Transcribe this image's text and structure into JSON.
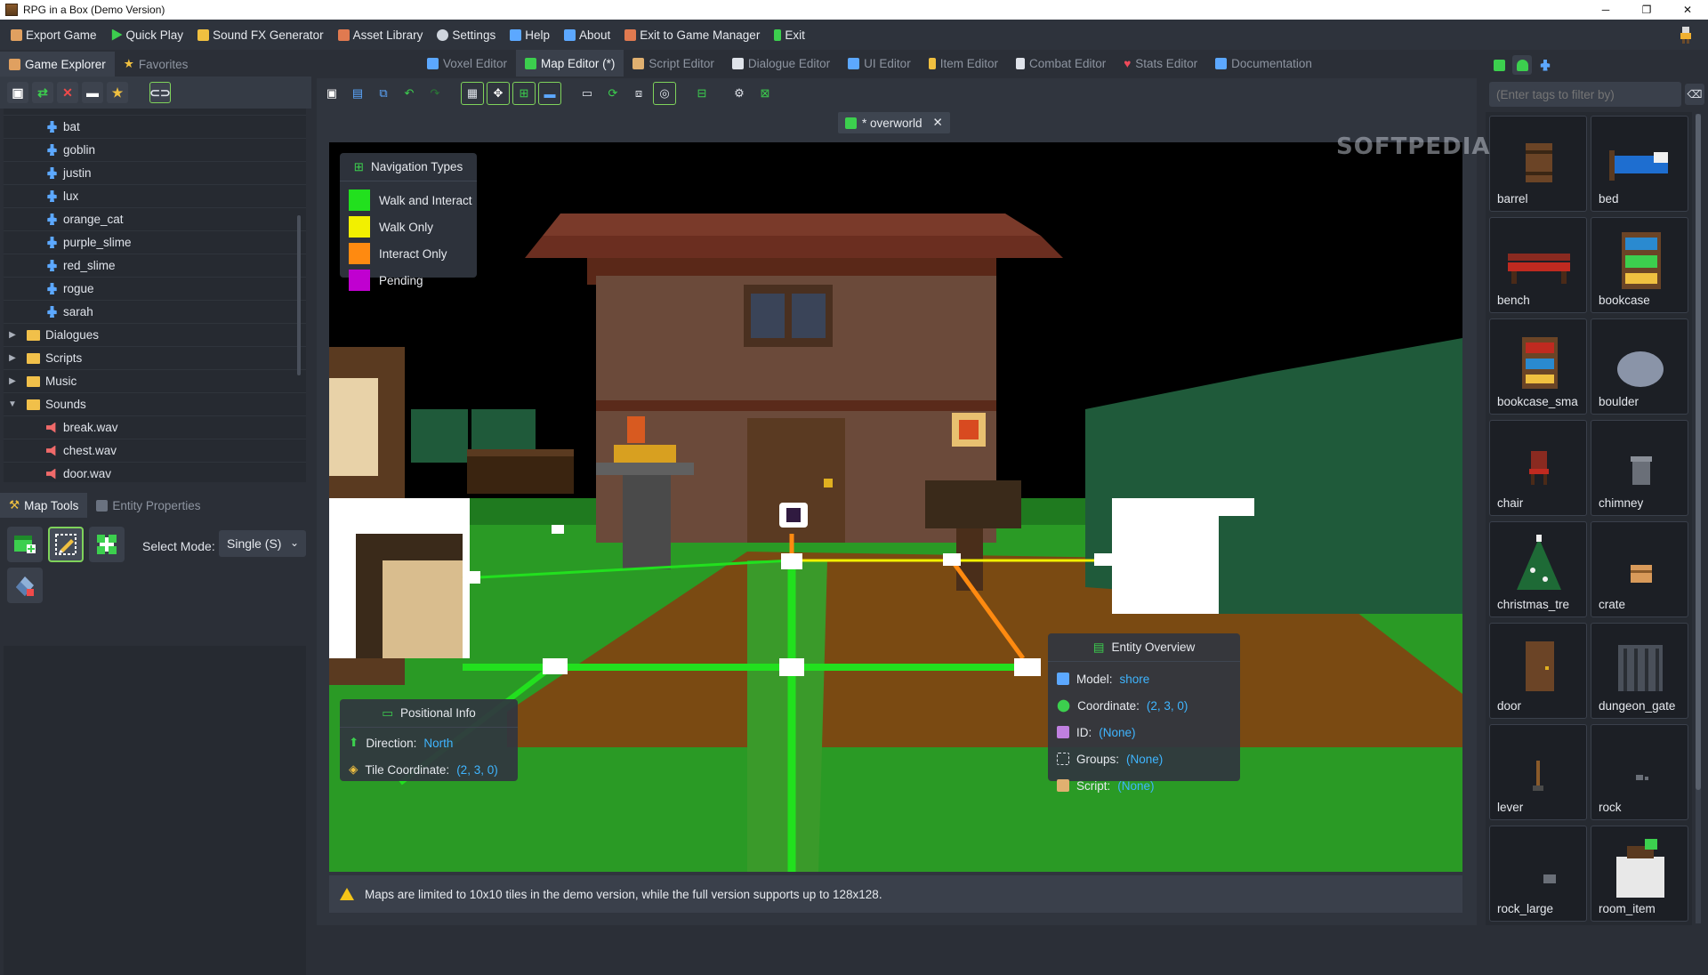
{
  "window": {
    "title": "RPG in a Box (Demo Version)",
    "minimize": "─",
    "maximize": "❐",
    "close": "✕"
  },
  "menu": [
    {
      "label": "Export Game",
      "color": "#e0a060"
    },
    {
      "label": "Quick Play",
      "color": "#3ccf4e"
    },
    {
      "label": "Sound FX Generator",
      "color": "#f0c040"
    },
    {
      "label": "Asset Library",
      "color": "#e07a50"
    },
    {
      "label": "Settings",
      "color": "#cfd5de"
    },
    {
      "label": "Help",
      "color": "#5ca8ff"
    },
    {
      "label": "About",
      "color": "#5ca8ff"
    },
    {
      "label": "Exit to Game Manager",
      "color": "#e07a50"
    },
    {
      "label": "Exit",
      "color": "#3ccf4e"
    }
  ],
  "left_dock": {
    "tabs": [
      "Game Explorer",
      "Favorites"
    ],
    "tree": {
      "characters": [
        "bat",
        "goblin",
        "justin",
        "lux",
        "orange_cat",
        "purple_slime",
        "red_slime",
        "rogue",
        "sarah"
      ],
      "folders": [
        "Dialogues",
        "Scripts",
        "Music",
        "Sounds"
      ],
      "sounds": [
        "break.wav",
        "chest.wav",
        "door.wav"
      ]
    },
    "lower_tabs": [
      "Map Tools",
      "Entity Properties"
    ],
    "select_mode_label": "Select Mode:",
    "select_mode_value": "Single (S)"
  },
  "editor_tabs": [
    {
      "label": "Voxel Editor",
      "color": "#5ca8ff"
    },
    {
      "label": "Map Editor (*)",
      "color": "#3ccf4e"
    },
    {
      "label": "Script Editor",
      "color": "#e0b070"
    },
    {
      "label": "Dialogue Editor",
      "color": "#dfe3ea"
    },
    {
      "label": "UI Editor",
      "color": "#5ca8ff"
    },
    {
      "label": "Item Editor",
      "color": "#f0c040"
    },
    {
      "label": "Combat Editor",
      "color": "#dfe3ea"
    },
    {
      "label": "Stats Editor",
      "color": "#f04a5a"
    },
    {
      "label": "Documentation",
      "color": "#5ca8ff"
    }
  ],
  "map_tab": {
    "label": "* overworld",
    "close": "✕"
  },
  "navigation_types": {
    "title": "Navigation Types",
    "items": [
      {
        "label": "Walk and Interact",
        "color": "#22e01e"
      },
      {
        "label": "Walk Only",
        "color": "#f2f000"
      },
      {
        "label": "Interact Only",
        "color": "#ff8a10"
      },
      {
        "label": "Pending",
        "color": "#c000d0"
      }
    ]
  },
  "positional_info": {
    "title": "Positional Info",
    "direction_label": "Direction:",
    "direction_value": "North",
    "tile_label": "Tile Coordinate:",
    "tile_value": "(2, 3, 0)"
  },
  "entity_overview": {
    "title": "Entity Overview",
    "rows": [
      {
        "label": "Model:",
        "value": "shore"
      },
      {
        "label": "Coordinate:",
        "value": "(2, 3, 0)"
      },
      {
        "label": "ID:",
        "value": "(None)"
      },
      {
        "label": "Groups:",
        "value": "(None)"
      },
      {
        "label": "Script:",
        "value": "(None)"
      }
    ]
  },
  "status_message": "Maps are limited to 10x10 tiles in the demo version, while the full version supports up to 128x128.",
  "right_dock": {
    "filter_placeholder": "(Enter tags to filter by)",
    "assets": [
      "barrel",
      "bed",
      "bench",
      "bookcase",
      "bookcase_sma",
      "boulder",
      "chair",
      "chimney",
      "christmas_tre",
      "crate",
      "door",
      "dungeon_gate",
      "lever",
      "rock",
      "rock_large",
      "room_item"
    ]
  },
  "watermark": "SOFTPEDIA"
}
